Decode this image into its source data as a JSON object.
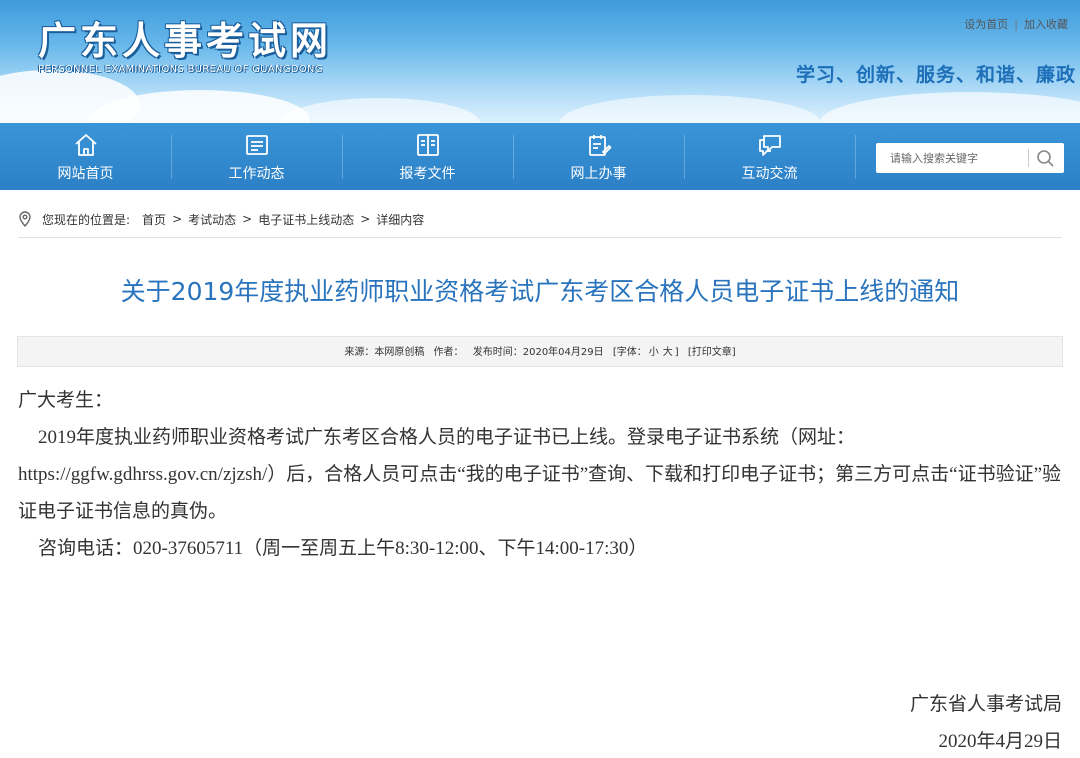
{
  "header": {
    "site_title": "广东人事考试网",
    "site_subtitle": "PERSONNEL EXAMINATIONS BUREAU OF GUANGDONG",
    "links": {
      "set_home": "设为首页",
      "add_fav": "加入收藏",
      "separator": "|"
    },
    "slogan": "学习、创新、服务、和谐、廉政"
  },
  "nav": {
    "items": [
      {
        "label": "网站首页",
        "icon": "home-icon"
      },
      {
        "label": "工作动态",
        "icon": "news-icon"
      },
      {
        "label": "报考文件",
        "icon": "document-book-icon"
      },
      {
        "label": "网上办事",
        "icon": "clipboard-edit-icon"
      },
      {
        "label": "互动交流",
        "icon": "chat-bubble-icon"
      }
    ],
    "search": {
      "placeholder": "请输入搜索关键字",
      "icon": "search-icon"
    }
  },
  "breadcrumb": {
    "prefix": "您现在的位置是:",
    "items": [
      "首页",
      "考试动态",
      "电子证书上线动态",
      "详细内容"
    ],
    "separator": ">"
  },
  "article": {
    "title": "关于2019年度执业药师职业资格考试广东考区合格人员电子证书上线的通知",
    "meta": {
      "source": "来源：本网原创稿",
      "author": "作者：",
      "date": "发布时间：2020年04月29日",
      "font_prefix": "[字体：",
      "font_small": "小",
      "font_large": "大",
      "font_suffix": "]",
      "print": "[打印文章]"
    },
    "greeting": "广大考生：",
    "paragraph1": "2019年度执业药师职业资格考试广东考区合格人员的电子证书已上线。登录电子证书系统（网址：https://ggfw.gdhrss.gov.cn/zjzsh/）后，合格人员可点击“我的电子证书”查询、下载和打印电子证书；第三方可点击“证书验证”验证电子证书信息的真伪。",
    "paragraph2": "咨询电话：020-37605711（周一至周五上午8:30-12:00、下午14:00-17:30）",
    "signature": "广东省人事考试局",
    "sign_date": "2020年4月29日"
  },
  "colors": {
    "nav_bg": "#2c80c6",
    "title_blue": "#2a74bd",
    "slogan_blue": "#1d6fb8"
  }
}
